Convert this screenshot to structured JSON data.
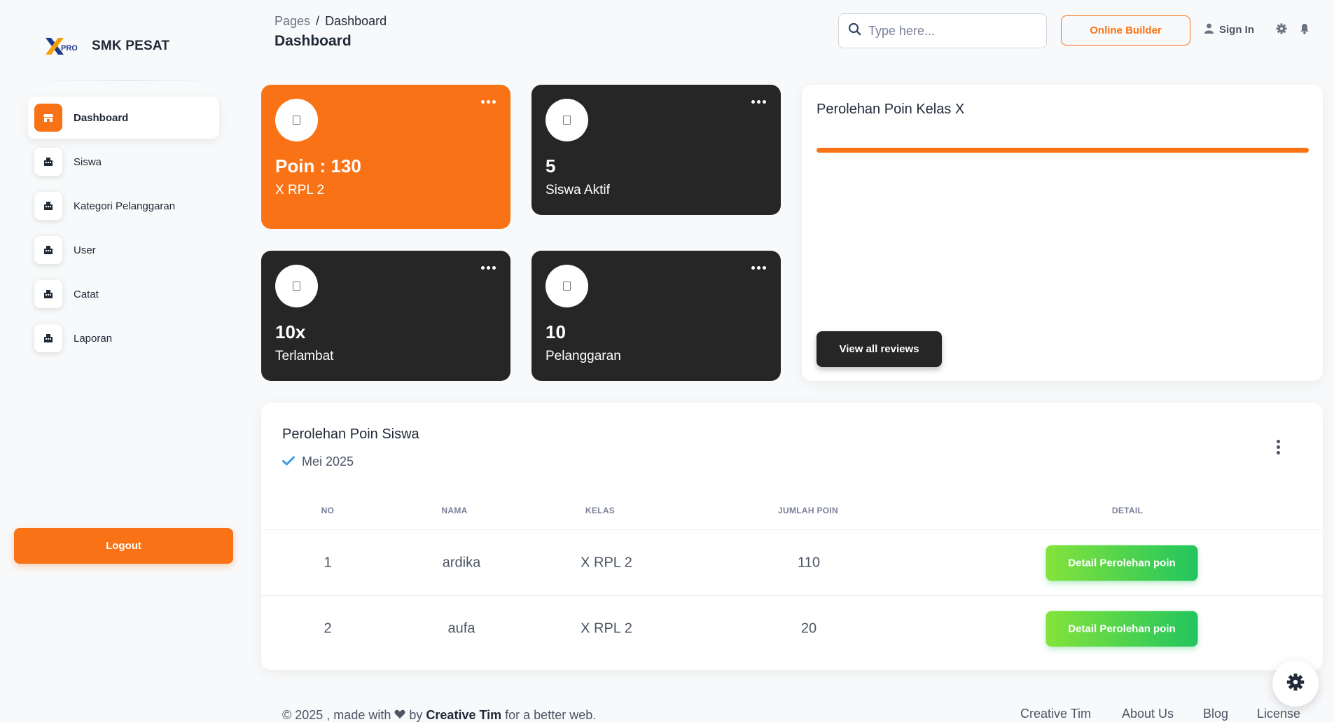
{
  "brand": {
    "name": "SMK PESAT",
    "logo_text": "PRO"
  },
  "sidebar": {
    "items": [
      {
        "label": "Dashboard",
        "active": true
      },
      {
        "label": "Siswa",
        "active": false
      },
      {
        "label": "Kategori Pelanggaran",
        "active": false
      },
      {
        "label": "User",
        "active": false
      },
      {
        "label": "Catat",
        "active": false
      },
      {
        "label": "Laporan",
        "active": false
      }
    ],
    "logout_label": "Logout"
  },
  "header": {
    "breadcrumb_root": "Pages",
    "breadcrumb_sep": "/",
    "breadcrumb_current": "Dashboard",
    "title": "Dashboard",
    "search_placeholder": "Type here...",
    "builder_label": "Online Builder",
    "signin_label": "Sign In"
  },
  "stats": [
    {
      "value": "Poin : 130",
      "label": "X RPL 2",
      "theme": "orange"
    },
    {
      "value": "5",
      "label": "Siswa Aktif",
      "theme": "dark"
    },
    {
      "value": "10x",
      "label": "Terlambat",
      "theme": "dark"
    },
    {
      "value": "10",
      "label": "Pelanggaran",
      "theme": "dark"
    }
  ],
  "chart_card": {
    "title": "Perolehan Poin Kelas X",
    "button_label": "View all reviews"
  },
  "table": {
    "title": "Perolehan Poin Siswa",
    "subtitle": "Mei 2025",
    "columns": [
      "NO",
      "NAMA",
      "KELAS",
      "JUMLAH POIN",
      "DETAIL"
    ],
    "rows": [
      {
        "no": "1",
        "nama": "ardika",
        "kelas": "X RPL 2",
        "poin": "110",
        "detail": "Detail Perolehan poin"
      },
      {
        "no": "2",
        "nama": "aufa",
        "kelas": "X RPL 2",
        "poin": "20",
        "detail": "Detail Perolehan poin"
      }
    ]
  },
  "footer": {
    "copyright": "© 2025 , made with",
    "by": "by",
    "author": "Creative Tim",
    "suffix": "for a better web.",
    "links": [
      "Creative Tim",
      "About Us",
      "Blog",
      "License"
    ]
  },
  "colors": {
    "accent": "#f97316",
    "dark": "#262626",
    "success": "#22c55e"
  }
}
